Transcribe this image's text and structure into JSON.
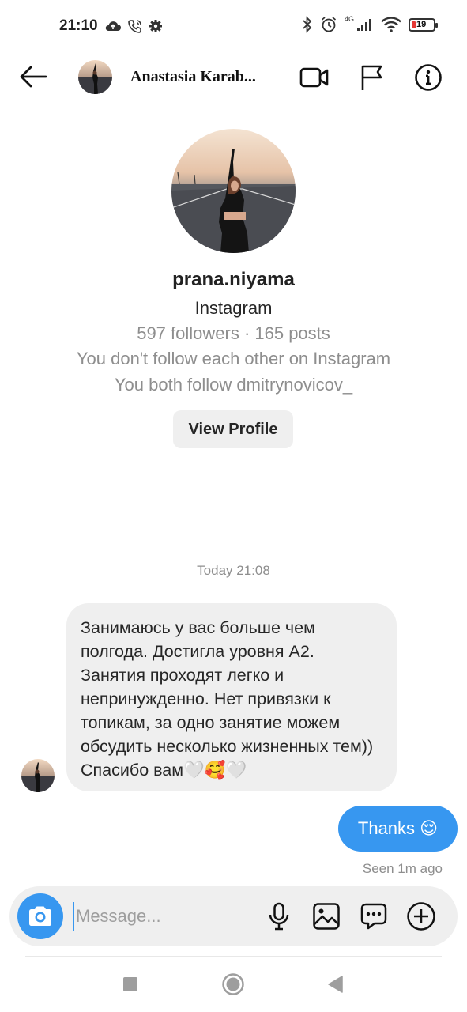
{
  "status_bar": {
    "time": "21:10",
    "network": "4G",
    "battery": "19",
    "battery_level": 0.19,
    "icons": [
      "cloud-upload-icon",
      "wifi-calling-icon",
      "settings-gear-icon",
      "bluetooth-icon",
      "alarm-icon",
      "signal-icon",
      "wifi-icon",
      "battery-icon"
    ]
  },
  "header": {
    "name": "Anastasia Karab...",
    "icons": [
      "back-arrow-icon",
      "video-call-icon",
      "flag-icon",
      "info-icon"
    ]
  },
  "profile": {
    "username": "prana.niyama",
    "source": "Instagram",
    "stats": "597 followers · 165 posts",
    "follow_status": "You don't follow each other on Instagram",
    "mutual": "You both follow dmitrynovicov_",
    "view_button": "View Profile"
  },
  "chat": {
    "timestamp": "Today 21:08",
    "incoming_message": "Занимаюсь у вас больше чем полгода. Достигла уровня А2. Занятия проходят легко и непринужденно. Нет привязки к топикам, за одно занятие можем обсудить несколько жизненных тем)) Спасибо вам🤍🥰🤍",
    "outgoing_message": "Thanks 😌",
    "seen": "Seen 1m ago"
  },
  "composer": {
    "placeholder": "Message...",
    "icons": [
      "camera-icon",
      "microphone-icon",
      "gallery-icon",
      "sticker-icon",
      "add-icon"
    ]
  },
  "colors": {
    "accent": "#3797f0",
    "bubble_incoming": "#efefef",
    "muted_text": "#8e8e8e",
    "battery_low": "#e53935"
  }
}
